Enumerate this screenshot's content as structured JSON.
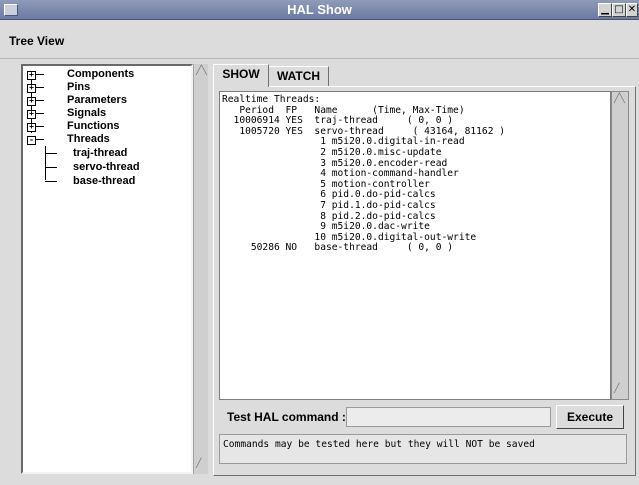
{
  "window": {
    "title": "HAL Show"
  },
  "menu": {
    "tree_view": "Tree View"
  },
  "tree": {
    "items": [
      {
        "label": "Components",
        "expander": "+"
      },
      {
        "label": "Pins",
        "expander": "+"
      },
      {
        "label": "Parameters",
        "expander": "+"
      },
      {
        "label": "Signals",
        "expander": "+"
      },
      {
        "label": "Functions",
        "expander": "+"
      },
      {
        "label": "Threads",
        "expander": "-"
      }
    ],
    "threads": [
      "traj-thread",
      "servo-thread",
      "base-thread"
    ]
  },
  "tabs": {
    "show": "SHOW",
    "watch": "WATCH"
  },
  "output": {
    "lines": [
      "Realtime Threads:",
      "   Period  FP   Name      (Time, Max-Time)",
      "  10006914 YES  traj-thread     ( 0, 0 )",
      "   1005720 YES  servo-thread     ( 43164, 81162 )",
      "                 1 m5i20.0.digital-in-read",
      "                 2 m5i20.0.misc-update",
      "                 3 m5i20.0.encoder-read",
      "                 4 motion-command-handler",
      "                 5 motion-controller",
      "                 6 pid.0.do-pid-calcs",
      "                 7 pid.1.do-pid-calcs",
      "                 8 pid.2.do-pid-calcs",
      "                 9 m5i20.0.dac-write",
      "                10 m5i20.0.digital-out-write",
      "     50286 NO   base-thread     ( 0, 0 )"
    ]
  },
  "command": {
    "label": "Test HAL command :",
    "value": "",
    "execute": "Execute",
    "message": "Commands may be tested here but they will NOT be saved"
  }
}
